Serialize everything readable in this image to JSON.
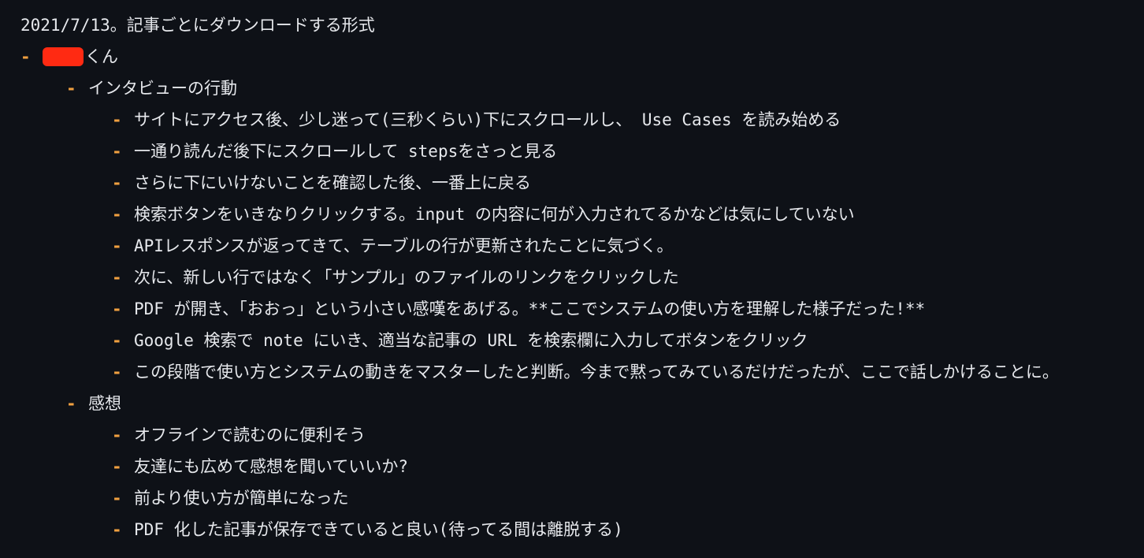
{
  "colors": {
    "background": "#0e1117",
    "text": "#e6e8ec",
    "bullet": "#f0a040",
    "redaction": "#ff2a12"
  },
  "title": "2021/7/13。記事ごとにダウンロードする形式",
  "bullet_char": "-",
  "person": {
    "suffix": "くん"
  },
  "sections": [
    {
      "heading": "インタビューの行動",
      "items": [
        "サイトにアクセス後、少し迷って(三秒くらい)下にスクロールし、 Use Cases を読み始める",
        "一通り読んだ後下にスクロールして stepsをさっと見る",
        "さらに下にいけないことを確認した後、一番上に戻る",
        "検索ボタンをいきなりクリックする。input の内容に何が入力されてるかなどは気にしていない",
        "APIレスポンスが返ってきて、テーブルの行が更新されたことに気づく。",
        "次に、新しい行ではなく「サンプル」のファイルのリンクをクリックした",
        "PDF が開き、「おおっ」という小さい感嘆をあげる。**ここでシステムの使い方を理解した様子だった!**",
        "Google 検索で note にいき、適当な記事の URL を検索欄に入力してボタンをクリック",
        "この段階で使い方とシステムの動きをマスターしたと判断。今まで黙ってみているだけだったが、ここで話しかけることに。"
      ]
    },
    {
      "heading": "感想",
      "items": [
        "オフラインで読むのに便利そう",
        "友達にも広めて感想を聞いていいか?",
        "前より使い方が簡単になった",
        "PDF 化した記事が保存できていると良い(待ってる間は離脱する)"
      ]
    }
  ]
}
